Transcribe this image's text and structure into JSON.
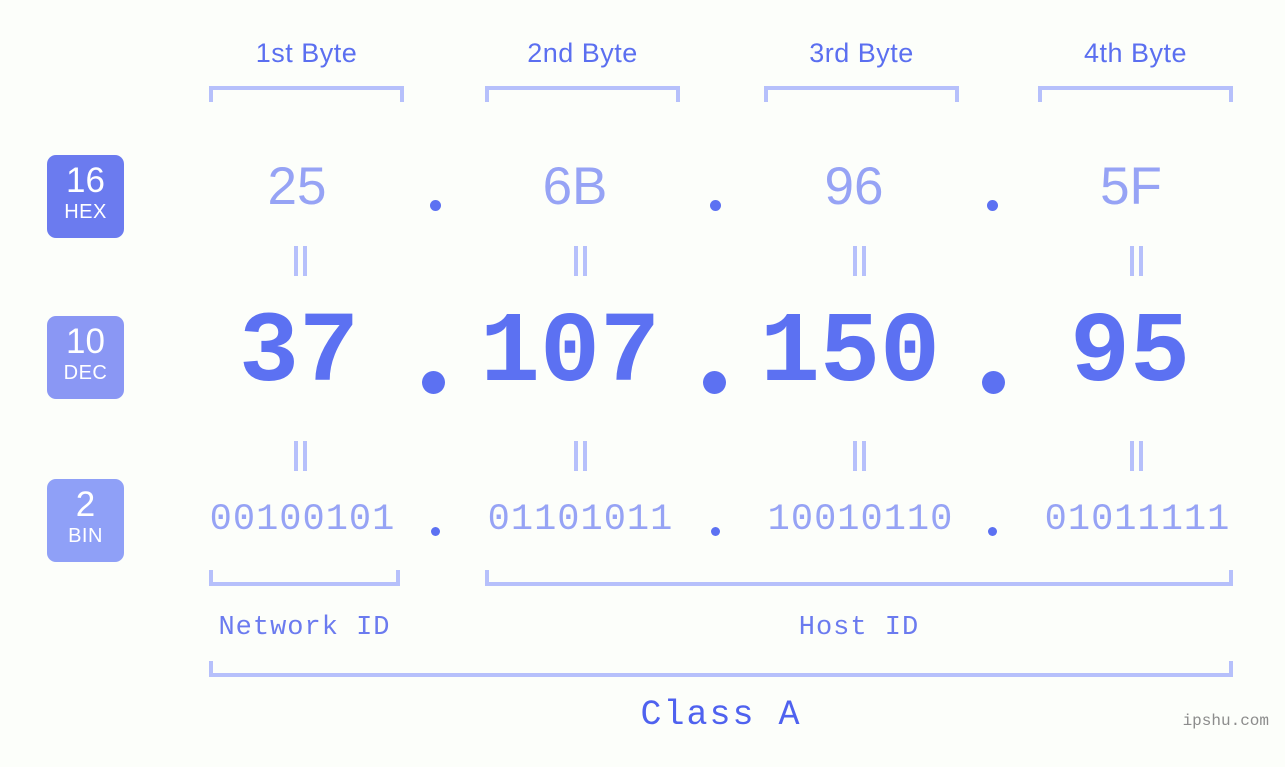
{
  "ip": {
    "dotted_decimal": "37.107.150.95",
    "class": "Class A"
  },
  "byte_headers": [
    {
      "label": "1st Byte"
    },
    {
      "label": "2nd Byte"
    },
    {
      "label": "3rd Byte"
    },
    {
      "label": "4th Byte"
    }
  ],
  "radix_badges": [
    {
      "number": "16",
      "name": "HEX",
      "color": "#6b7bef"
    },
    {
      "number": "10",
      "name": "DEC",
      "color": "#8a97f4"
    },
    {
      "number": "2",
      "name": "BIN",
      "color": "#8fa0f7"
    }
  ],
  "rows": {
    "hex": {
      "values": [
        "25",
        "6B",
        "96",
        "5F"
      ],
      "separator": "."
    },
    "dec": {
      "values": [
        "37",
        "107",
        "150",
        "95"
      ],
      "separator": "."
    },
    "bin": {
      "values": [
        "00100101",
        "01101011",
        "10010110",
        "01011111"
      ],
      "separator": "."
    }
  },
  "equals_marks": {
    "glyph": "=",
    "count_per_row": 4
  },
  "segments": {
    "network_id": "Network ID",
    "host_id": "Host ID"
  },
  "class_label": "Class A",
  "watermark": "ipshu.com",
  "colors": {
    "background": "#fcfefa",
    "accent_strong": "#5c71f2",
    "accent_light": "#96a3f5",
    "bracket": "#b6c0fb",
    "header_text": "#5b6ff0",
    "watermark_text": "#8c8c8c"
  }
}
